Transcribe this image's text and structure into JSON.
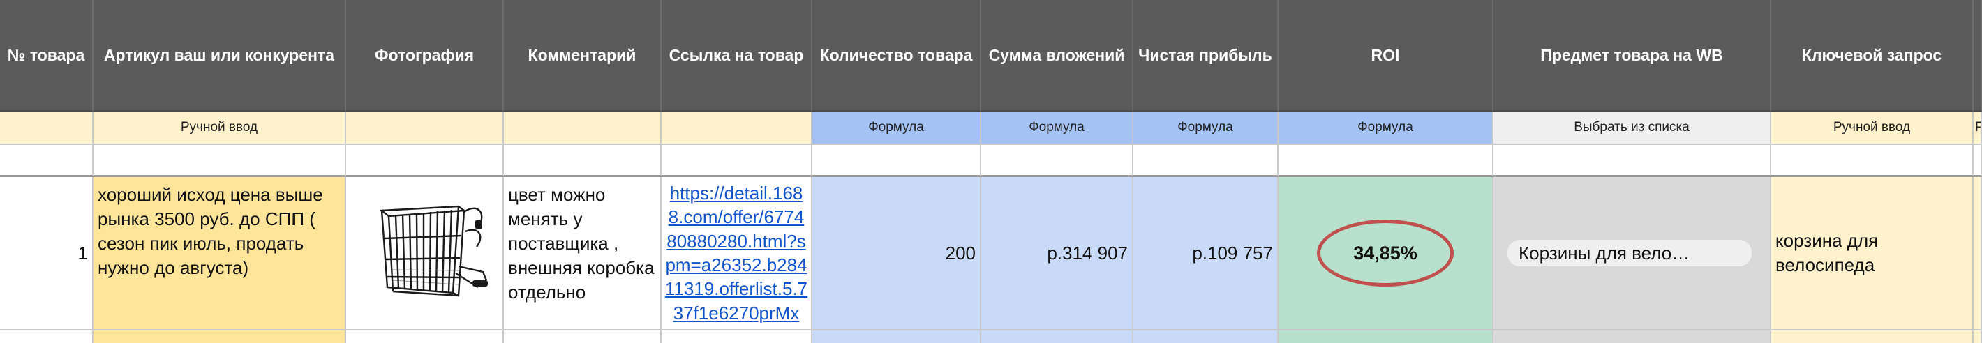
{
  "headers": [
    "№ товара",
    "Артикул ваш или конкурента",
    "Фотография",
    "Комментарий",
    "Ссылка на товар",
    "Количество товара",
    "Сумма вложений",
    "Чистая прибыль",
    "ROI",
    "Предмет товара на WB",
    "Ключевой запрос"
  ],
  "subrow": {
    "manual_input": "Ручной ввод",
    "formula": "Формула",
    "choose_from_list": "Выбрать из списка",
    "manual_input_2": "Ручной ввод",
    "partial_next": "Р"
  },
  "product": {
    "number": "1",
    "article": "хороший исход цена выше рынка 3500 руб. до СПП ( сезон пик июль, продать нужно до августа)",
    "photo_icon": "bicycle-basket-photo",
    "comment": "цвет можно менять у поставщика , внешняя коробка отдельно",
    "link": "https://detail.1688.com/offer/677480880280.html?spm=a26352.b28411319.offerlist.5.737f1e6270prMx",
    "quantity": "200",
    "investment": "р.314 907",
    "net_profit": "р.109 757",
    "roi": "34,85%",
    "wb_subject": "Корзины для вело…",
    "keyword": "корзина для велосипеда"
  },
  "colors": {
    "header_bg": "#5b5b5b",
    "manual_bg": "#fff2cc",
    "formula_bg": "#a4c2f4",
    "data_yellow": "#ffe599",
    "data_blue": "#c9daf8",
    "data_green": "#b7e1cd",
    "roi_circle": "#c0504d",
    "link": "#1155cc"
  }
}
